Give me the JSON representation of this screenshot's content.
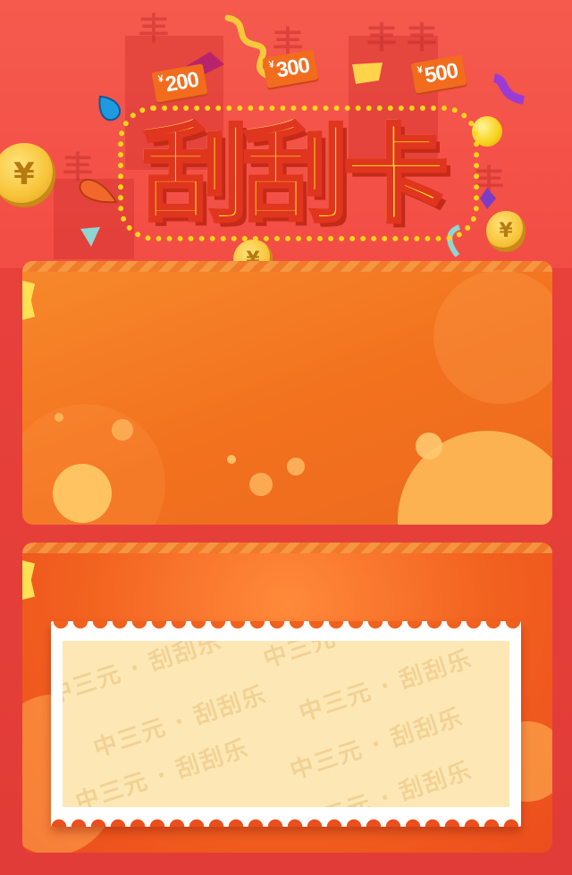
{
  "title": "刮刮卡",
  "prize_tags": [
    {
      "currency": "¥",
      "amount": "200"
    },
    {
      "currency": "¥",
      "amount": "300"
    },
    {
      "currency": "¥",
      "amount": "500"
    }
  ],
  "coin_symbol": "¥",
  "scratch_card": {
    "watermark_text": "中三元 · 刮刮乐"
  },
  "colors": {
    "background": "#f24a43",
    "card_orange": "#f2711e",
    "title_yellow": "#ffe81a",
    "ticket_fill": "#fde8b5"
  }
}
